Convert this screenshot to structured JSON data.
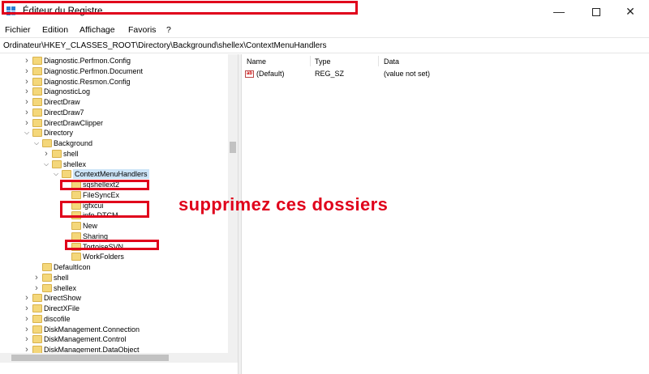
{
  "window": {
    "title": "Éditeur du Registre",
    "minimize": "—",
    "close": "✕"
  },
  "menu": [
    "Fichier",
    "Edition",
    "Affichage",
    "Favoris",
    "?"
  ],
  "address": "Ordinateur\\HKEY_CLASSES_ROOT\\Directory\\Background\\shellex\\ContextMenuHandlers",
  "tree": [
    {
      "label": "Diagnostic.Perfmon.Config",
      "level": 0,
      "arrow": ">"
    },
    {
      "label": "Diagnostic.Perfmon.Document",
      "level": 0,
      "arrow": ">"
    },
    {
      "label": "Diagnostic.Resmon.Config",
      "level": 0,
      "arrow": ">"
    },
    {
      "label": "DiagnosticLog",
      "level": 0,
      "arrow": ">"
    },
    {
      "label": "DirectDraw",
      "level": 0,
      "arrow": ">"
    },
    {
      "label": "DirectDraw7",
      "level": 0,
      "arrow": ">"
    },
    {
      "label": "DirectDrawClipper",
      "level": 0,
      "arrow": ">"
    },
    {
      "label": "Directory",
      "level": 0,
      "arrow": "v"
    },
    {
      "label": "Background",
      "level": 1,
      "arrow": "v"
    },
    {
      "label": "shell",
      "level": 2,
      "arrow": ">"
    },
    {
      "label": "shellex",
      "level": 2,
      "arrow": "v"
    },
    {
      "label": "ContextMenuHandlers",
      "level": 3,
      "arrow": "v",
      "selected": true
    },
    {
      "label": "sqshellext2",
      "level": 4,
      "arrow": ""
    },
    {
      "label": "FileSyncEx",
      "level": 4,
      "arrow": ""
    },
    {
      "label": "igfxcui",
      "level": 4,
      "arrow": ""
    },
    {
      "label": "info-DTCM",
      "level": 4,
      "arrow": ""
    },
    {
      "label": "New",
      "level": 4,
      "arrow": ""
    },
    {
      "label": "Sharing",
      "level": 4,
      "arrow": ""
    },
    {
      "label": "TortoiseSVN",
      "level": 4,
      "arrow": ""
    },
    {
      "label": "WorkFolders",
      "level": 4,
      "arrow": ""
    },
    {
      "label": "DefaultIcon",
      "level": 1,
      "arrow": ""
    },
    {
      "label": "shell",
      "level": 1,
      "arrow": ">"
    },
    {
      "label": "shellex",
      "level": 1,
      "arrow": ">"
    },
    {
      "label": "DirectShow",
      "level": 0,
      "arrow": ">"
    },
    {
      "label": "DirectXFile",
      "level": 0,
      "arrow": ">"
    },
    {
      "label": "discofile",
      "level": 0,
      "arrow": ">"
    },
    {
      "label": "DiskManagement.Connection",
      "level": 0,
      "arrow": ">"
    },
    {
      "label": "DiskManagement.Control",
      "level": 0,
      "arrow": ">"
    },
    {
      "label": "DiskManagement.DataObject",
      "level": 0,
      "arrow": ">"
    }
  ],
  "columns": {
    "name": "Name",
    "type": "Type",
    "data": "Data"
  },
  "values": [
    {
      "icon": "ab",
      "name": "(Default)",
      "type": "REG_SZ",
      "data": "(value not set)"
    }
  ],
  "annotation": "supprimez ces dossiers",
  "highlight_color": "#e0001b",
  "folder_color": "#f4d77a",
  "selection_color": "#cce4f7"
}
